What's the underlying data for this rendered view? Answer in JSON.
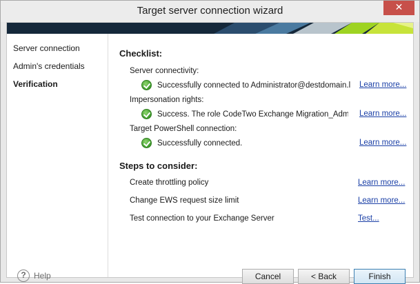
{
  "window": {
    "title": "Target server connection wizard",
    "close_glyph": "✕"
  },
  "sidebar": {
    "items": [
      {
        "label": "Server connection",
        "active": false
      },
      {
        "label": "Admin's credentials",
        "active": false
      },
      {
        "label": "Verification",
        "active": true
      }
    ],
    "help_label": "Help",
    "help_glyph": "?"
  },
  "checklist": {
    "title": "Checklist:",
    "items": [
      {
        "label": "Server connectivity:",
        "status": "Successfully connected to Administrator@destdomain.lan.",
        "link": "Learn more..."
      },
      {
        "label": "Impersonation rights:",
        "status": "Success. The role CodeTwo Exchange Migration_Administrator",
        "link": "Learn more..."
      },
      {
        "label": "Target PowerShell connection:",
        "status": "Successfully connected.",
        "link": "Learn more..."
      }
    ]
  },
  "steps": {
    "title": "Steps to consider:",
    "items": [
      {
        "label": "Create throttling policy",
        "link": "Learn more..."
      },
      {
        "label": "Change EWS request size limit",
        "link": "Learn more..."
      },
      {
        "label": "Test connection to your Exchange Server",
        "link": "Test..."
      }
    ]
  },
  "buttons": {
    "cancel": "Cancel",
    "back": "< Back",
    "finish": "Finish"
  },
  "colors": {
    "accent": "#3c7fb1",
    "close": "#c7504a",
    "link": "#1a3fa6",
    "success": "#3d9a2a"
  }
}
